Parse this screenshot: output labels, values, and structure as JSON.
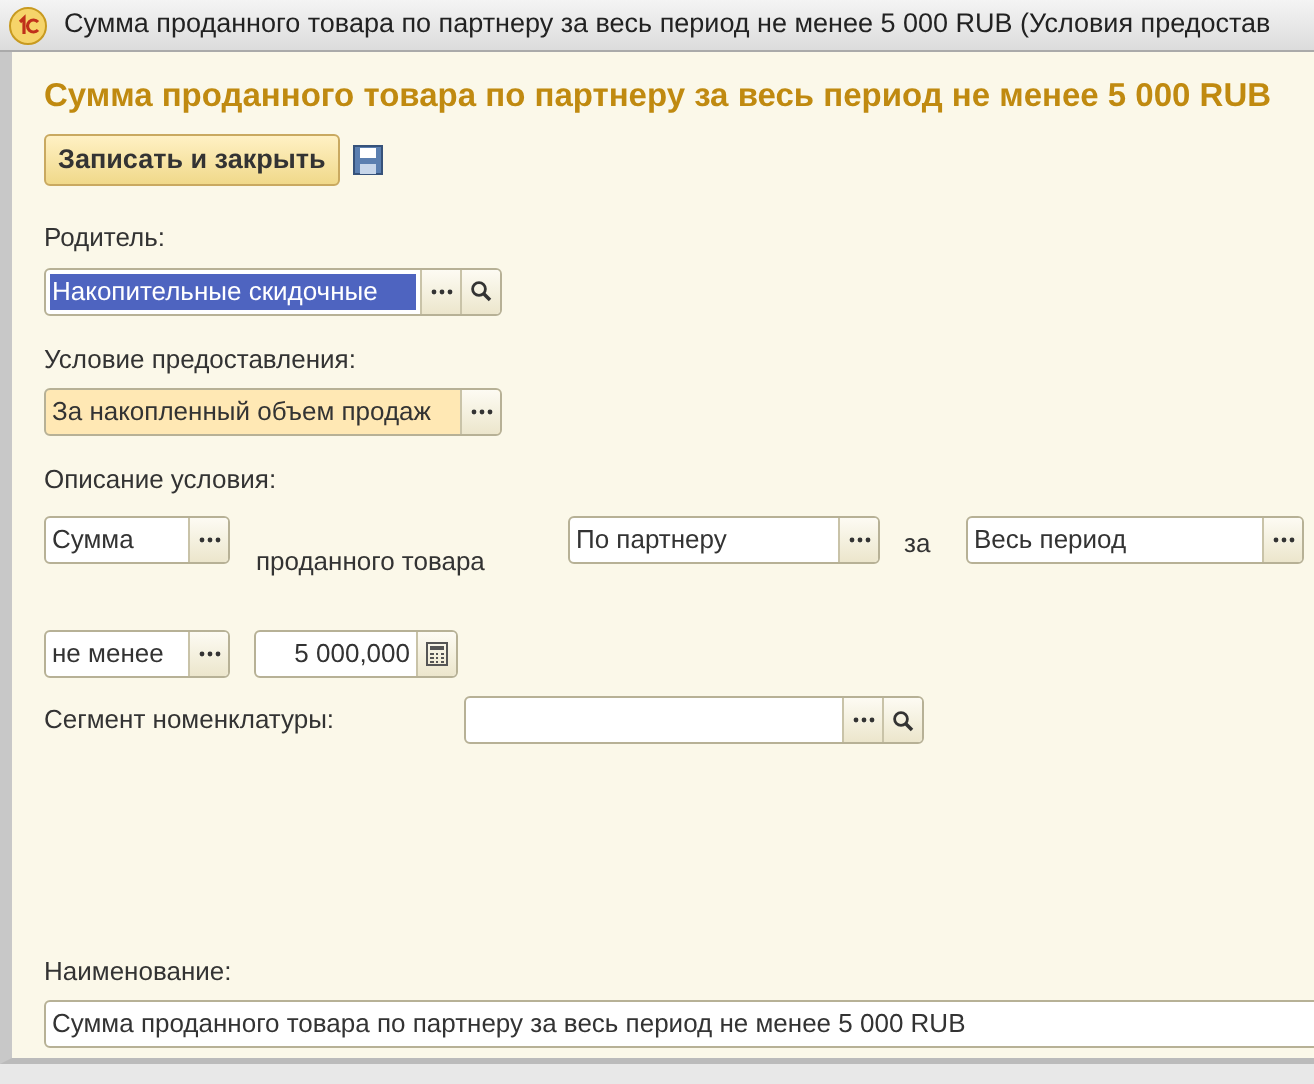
{
  "window": {
    "title": "Сумма проданного товара по партнеру за весь период не менее 5 000 RUB (Условия предостав"
  },
  "heading": "Сумма проданного товара по партнеру за весь период не менее 5 000 RUB",
  "toolbar": {
    "save_close_button": "Записать и закрыть"
  },
  "parent": {
    "label": "Родитель:",
    "value": "Накопительные скидочные",
    "selected": true
  },
  "condition": {
    "label": "Условие предоставления:",
    "value": "За накопленный объем продаж"
  },
  "description": {
    "label": "Описание условия:",
    "aggregate": "Сумма",
    "text": "проданного товара",
    "scope": "По партнеру",
    "connector": "за",
    "period": "Весь период",
    "comparison": "не менее",
    "amount": "5 000,000"
  },
  "segment": {
    "label": "Сегмент номенклатуры:"
  },
  "name": {
    "label": "Наименование:",
    "value": "Сумма проданного товара по партнеру за весь период не менее 5 000 RUB"
  }
}
